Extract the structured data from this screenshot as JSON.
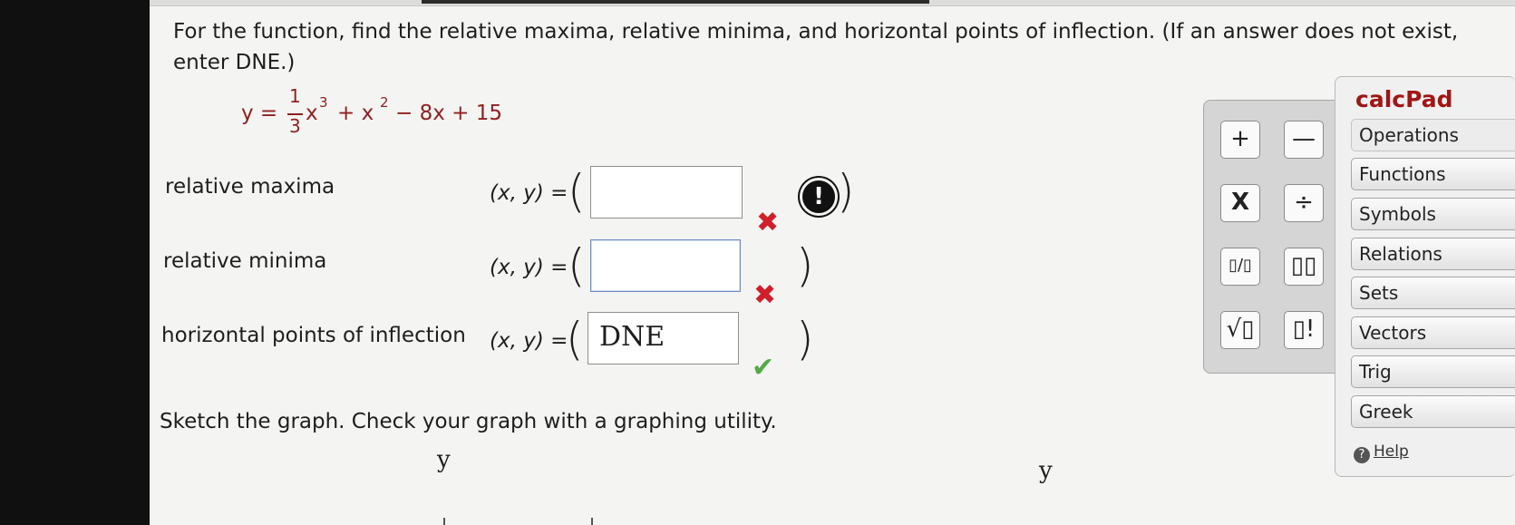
{
  "question": "For the function, find the relative maxima, relative minima, and horizontal points of inflection. (If an answer does not exist, enter DNE.)",
  "equation": {
    "lhs": "y =",
    "frac_num": "1",
    "frac_den": "3",
    "var": "x",
    "exp1": "3",
    "plus1": "+ x",
    "exp2": "2",
    "rest": "− 8x + 15"
  },
  "rows": [
    {
      "label": "relative maxima",
      "xy": "(x, y) =",
      "value": "",
      "status": "incorrect"
    },
    {
      "label": "relative minima",
      "xy": "(x, y) =",
      "value": "",
      "status": "incorrect"
    },
    {
      "label": "horizontal points of inflection",
      "xy": "(x, y) =",
      "value": "DNE",
      "status": "correct"
    }
  ],
  "alert_symbol": "!",
  "paren_open": "(",
  "paren_close": ")",
  "mark_incorrect": "✖",
  "mark_correct": "✔",
  "sketch_text": "Sketch the graph. Check your graph with a graphing utility.",
  "axis_labels": [
    "y",
    "y"
  ],
  "calculator": {
    "title": "calcPad",
    "keys": [
      "+",
      "—",
      "X",
      "÷",
      "▯/▯",
      "▯▯",
      "√▯",
      "▯!"
    ],
    "tabs": [
      "Operations",
      "Functions",
      "Symbols",
      "Relations",
      "Sets",
      "Vectors",
      "Trig",
      "Greek"
    ],
    "help": "Help",
    "help_icon": "?"
  },
  "colors": {
    "equation": "#8f1f1f",
    "incorrect": "#d01f2b",
    "correct": "#55a94a",
    "calc_title": "#a01515"
  }
}
